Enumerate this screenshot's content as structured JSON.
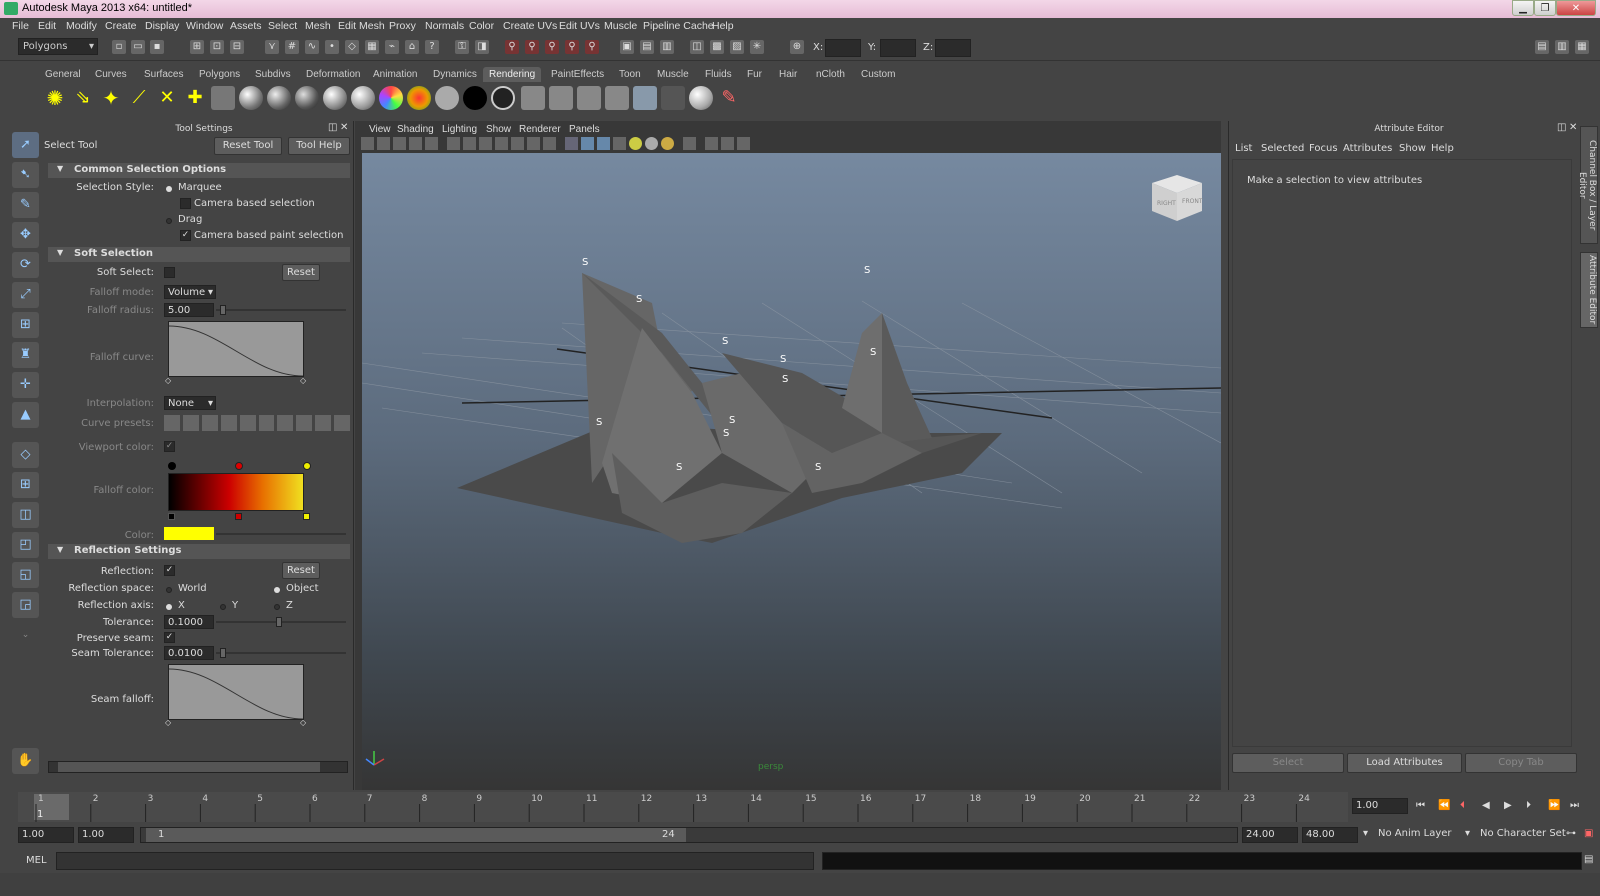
{
  "window": {
    "title": "Autodesk Maya 2013 x64: untitled*"
  },
  "menu": [
    "File",
    "Edit",
    "Modify",
    "Create",
    "Display",
    "Window",
    "Assets",
    "Select",
    "Mesh",
    "Edit Mesh",
    "Proxy",
    "Normals",
    "Color",
    "Create UVs",
    "Edit UVs",
    "Muscle",
    "Pipeline Cache",
    "Help"
  ],
  "status": {
    "menuset": "Polygons",
    "x_label": "X:",
    "y_label": "Y:",
    "z_label": "Z:"
  },
  "shelf": {
    "tabs": [
      "General",
      "Curves",
      "Surfaces",
      "Polygons",
      "Subdivs",
      "Deformation",
      "Animation",
      "Dynamics",
      "Rendering",
      "PaintEffects",
      "Toon",
      "Muscle",
      "Fluids",
      "Fur",
      "Hair",
      "nCloth",
      "Custom"
    ],
    "active": "Rendering"
  },
  "tool_settings": {
    "panel_title": "Tool Settings",
    "tool_name": "Select Tool",
    "reset_tool": "Reset Tool",
    "tool_help": "Tool Help",
    "common": {
      "header": "Common Selection Options",
      "selection_style_label": "Selection Style:",
      "marquee": "Marquee",
      "camera_based_selection": "Camera based selection",
      "drag": "Drag",
      "camera_based_paint": "Camera based paint selection"
    },
    "soft": {
      "header": "Soft Selection",
      "soft_select_label": "Soft Select:",
      "reset": "Reset",
      "falloff_mode_label": "Falloff mode:",
      "falloff_mode_value": "Volume",
      "falloff_radius_label": "Falloff radius:",
      "falloff_radius_value": "5.00",
      "falloff_curve_label": "Falloff curve:",
      "interpolation_label": "Interpolation:",
      "interpolation_value": "None",
      "curve_presets_label": "Curve presets:",
      "viewport_color_label": "Viewport color:",
      "falloff_color_label": "Falloff color:",
      "color_label": "Color:"
    },
    "reflection": {
      "header": "Reflection Settings",
      "reflection_label": "Reflection:",
      "reset": "Reset",
      "space_label": "Reflection space:",
      "world": "World",
      "object": "Object",
      "axis_label": "Reflection axis:",
      "x": "X",
      "y": "Y",
      "z": "Z",
      "tolerance_label": "Tolerance:",
      "tolerance_value": "0.1000",
      "preserve_seam_label": "Preserve seam:",
      "seam_tolerance_label": "Seam Tolerance:",
      "seam_tolerance_value": "0.0100",
      "seam_falloff_label": "Seam falloff:"
    }
  },
  "viewport": {
    "menu": [
      "View",
      "Shading",
      "Lighting",
      "Show",
      "Renderer",
      "Panels"
    ],
    "camera_label": "persp",
    "viewcube_right": "RIGHT",
    "viewcube_front": "FRONT",
    "marker": "S"
  },
  "attribute_editor": {
    "title": "Attribute Editor",
    "menu": [
      "List",
      "Selected",
      "Focus",
      "Attributes",
      "Show",
      "Help"
    ],
    "message": "Make a selection to view attributes",
    "select_btn": "Select",
    "load_btn": "Load Attributes",
    "copy_btn": "Copy Tab",
    "side_tabs": [
      "Channel Box / Layer Editor",
      "Attribute Editor"
    ]
  },
  "timeline": {
    "ticks": [
      "1",
      "2",
      "3",
      "4",
      "5",
      "6",
      "7",
      "8",
      "9",
      "10",
      "11",
      "12",
      "13",
      "14",
      "15",
      "16",
      "17",
      "18",
      "19",
      "20",
      "21",
      "22",
      "23",
      "24"
    ],
    "current_frame_marker": "1",
    "current_time": "1.00"
  },
  "range": {
    "start": "1.00",
    "playback_start": "1.00",
    "slider_start": "1",
    "slider_end": "24",
    "playback_end": "24.00",
    "end": "48.00",
    "anim_layer": "No Anim Layer",
    "character_set": "No Character Set"
  },
  "command": {
    "label": "MEL"
  },
  "colors": {
    "accent": "#5d5d5d",
    "falloff_start": "#000000",
    "falloff_mid": "#d00000",
    "falloff_end": "#f0e020",
    "soft_color": "#ffff00"
  }
}
